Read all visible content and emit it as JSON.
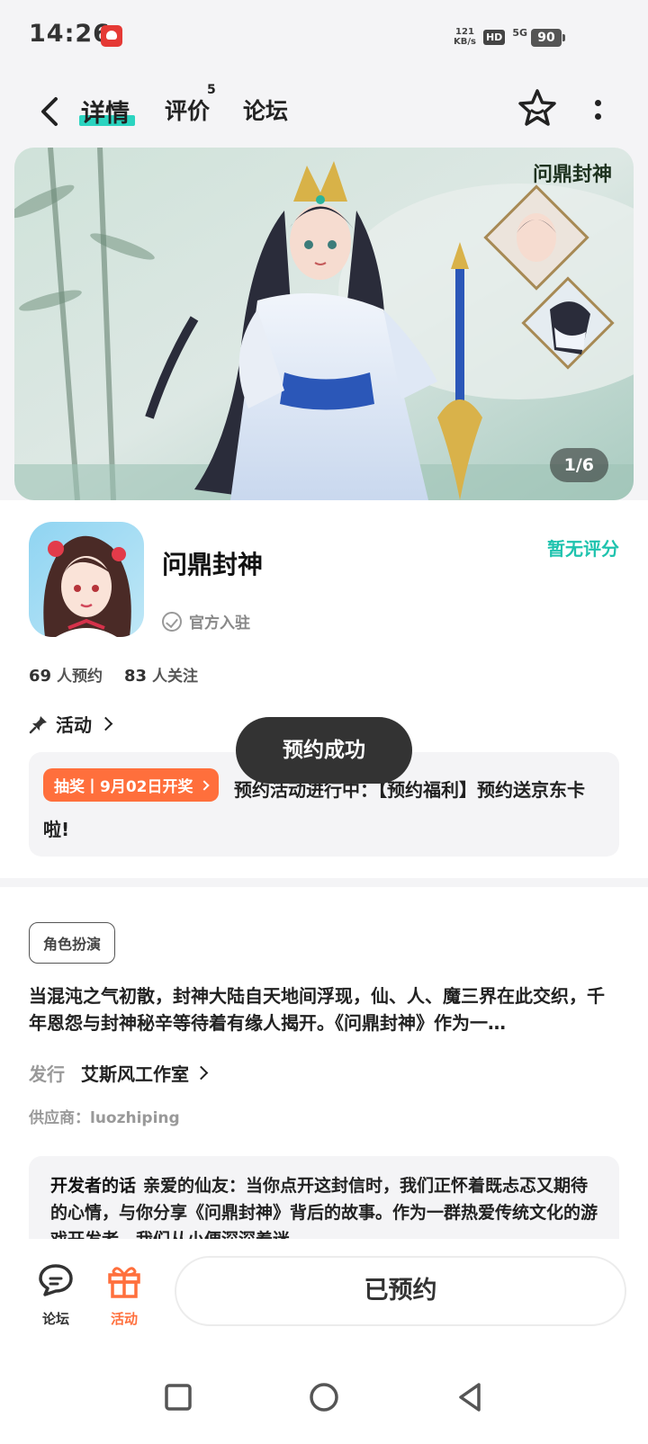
{
  "status_bar": {
    "time": "14:26",
    "net_speed_value": "121",
    "net_speed_unit": "KB/s",
    "hd_label": "HD",
    "network": "5G",
    "battery": "90"
  },
  "header": {
    "tabs": [
      {
        "label": "详情",
        "active": true
      },
      {
        "label": "评价",
        "count": "5"
      },
      {
        "label": "论坛"
      }
    ]
  },
  "banner": {
    "counter": "1/6",
    "logo_text": "问鼎封神"
  },
  "app": {
    "name": "问鼎封神",
    "rating": "暂无评分",
    "official_label": "官方入驻",
    "reservations_count": "69",
    "reservations_label": "人预约",
    "followers_count": "83",
    "followers_label": "人关注"
  },
  "activity": {
    "title": "活动",
    "tag": "抽奖丨9月02日开奖",
    "text": "预约活动进行中：【预约福利】预约送京东卡啦!"
  },
  "toast": {
    "text": "预约成功"
  },
  "details": {
    "genre": "角色扮演",
    "description": "当混沌之气初散，封神大陆自天地间浮现，仙、人、魔三界在此交织，千年恩怨与封神秘辛等待着有缘人揭开。《问鼎封神》作为一…",
    "publisher_label": "发行",
    "publisher_name": "艾斯风工作室",
    "supplier": "供应商：luozhiping"
  },
  "developer_note": {
    "label": "开发者的话",
    "text": "亲爱的仙友：当你点开这封信时，我们正怀着既忐忑又期待的心情，与你分享《问鼎封神》背后的故事。作为一群热爱传统文化的游戏开发者，我们从小便深深着迷"
  },
  "bottom_bar": {
    "forum_label": "论坛",
    "activity_label": "活动",
    "reserve_button": "已预约"
  },
  "colors": {
    "accent": "#2bd4c0",
    "rating": "#1fc3ae",
    "orange": "#ff6f3c",
    "background": "#f4f4f6"
  }
}
